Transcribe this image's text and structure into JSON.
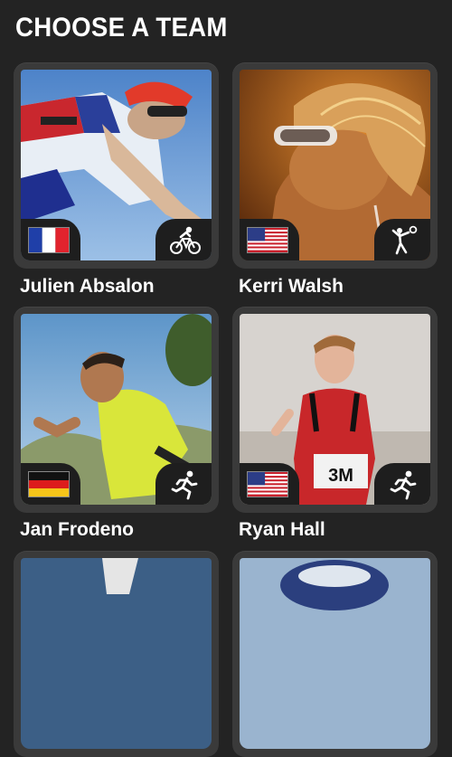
{
  "page": {
    "title": "CHOOSE A TEAM"
  },
  "athletes": [
    {
      "name": "Julien Absalon",
      "flag": "france-flag",
      "sport": "cycling-icon"
    },
    {
      "name": "Kerri Walsh",
      "flag": "usa-flag",
      "sport": "volleyball-icon"
    },
    {
      "name": "Jan Frodeno",
      "flag": "germany-flag",
      "sport": "running-icon"
    },
    {
      "name": "Ryan Hall",
      "flag": "usa-flag",
      "sport": "running-icon"
    }
  ]
}
